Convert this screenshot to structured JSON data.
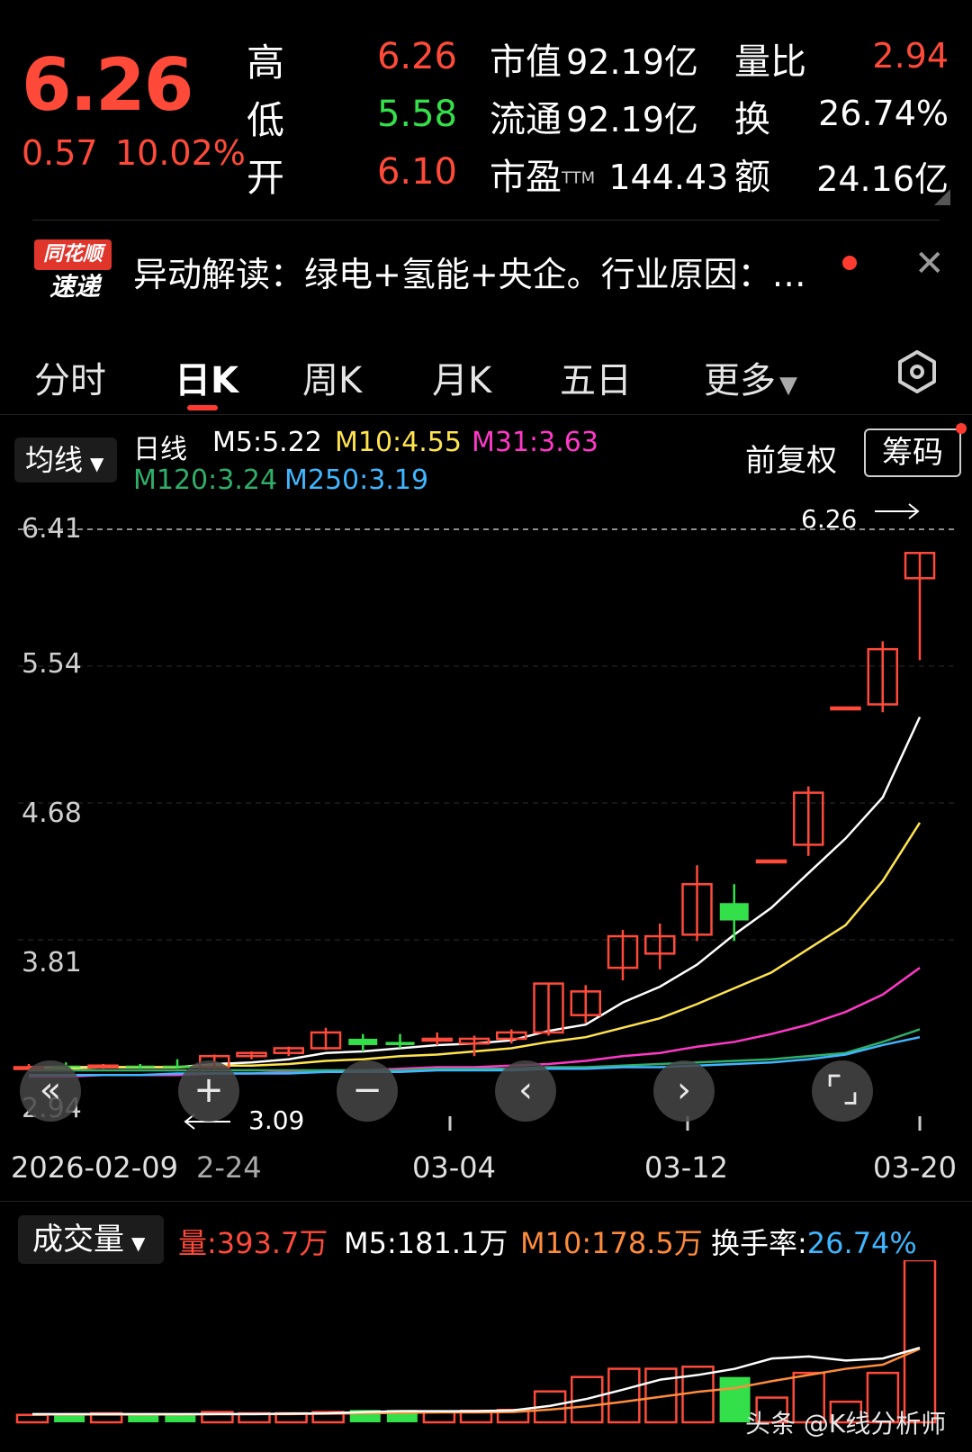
{
  "quote": {
    "price": "6.26",
    "change": "0.57",
    "change_pct": "10.02%",
    "high_label": "高",
    "high": "6.26",
    "low_label": "低",
    "low": "5.58",
    "open_label": "开",
    "open": "6.10",
    "mktcap_label": "市值",
    "mktcap": "92.19亿",
    "float_label": "流通",
    "float": "92.19亿",
    "pe_label": "市盈",
    "pe_sup": "TTM",
    "pe": "144.43",
    "volratio_label": "量比",
    "volratio": "2.94",
    "turnover_label": "换",
    "turnover": "26.74%",
    "amount_label": "额",
    "amount": "24.16亿",
    "colors": {
      "up": "#ff4a3a",
      "down": "#33e04a"
    }
  },
  "news": {
    "logo_top": "同花顺",
    "logo_bottom": "速递",
    "text": "异动解读：绿电+氢能+央企。行业原因：…"
  },
  "tabs": [
    {
      "label": "分时"
    },
    {
      "label": "日K",
      "active": true
    },
    {
      "label": "周K"
    },
    {
      "label": "月K"
    },
    {
      "label": "五日"
    },
    {
      "label": "更多"
    }
  ],
  "ma_bar": {
    "select": "均线",
    "day": "日线",
    "m5": "M5:5.22",
    "m10": "M10:4.55",
    "m31": "M31:3.63",
    "m120": "M120:3.24",
    "m250": "M250:3.19",
    "fuquan": "前复权",
    "chouma": "筹码"
  },
  "volume_bar": {
    "select": "成交量",
    "vol": "量:393.7万",
    "m5": "M5:181.1万",
    "m10": "M10:178.5万",
    "turnover_label": "换手率:",
    "turnover": "26.74%"
  },
  "watermark": "头条 @K线分析师",
  "chart_data": {
    "type": "candlestick",
    "y_ticks": [
      "6.41",
      "5.54",
      "4.68",
      "3.81",
      "2.94"
    ],
    "ylim": [
      2.94,
      6.41
    ],
    "x_ticks": [
      "2026-02-09",
      "2-24",
      "03-04",
      "03-12",
      "03-20"
    ],
    "high_marker": "6.26",
    "low_marker": "3.09",
    "candles": [
      {
        "o": 3.0,
        "h": 3.02,
        "l": 2.99,
        "c": 3.0
      },
      {
        "o": 3.01,
        "h": 3.03,
        "l": 2.99,
        "c": 3.0
      },
      {
        "o": 3.0,
        "h": 3.02,
        "l": 2.99,
        "c": 3.01
      },
      {
        "o": 3.01,
        "h": 3.02,
        "l": 2.99,
        "c": 3.0
      },
      {
        "o": 3.01,
        "h": 3.05,
        "l": 2.99,
        "c": 3.0
      },
      {
        "o": 3.0,
        "h": 3.08,
        "l": 2.99,
        "c": 3.07
      },
      {
        "o": 3.07,
        "h": 3.1,
        "l": 3.05,
        "c": 3.09
      },
      {
        "o": 3.09,
        "h": 3.13,
        "l": 3.07,
        "c": 3.12
      },
      {
        "o": 3.12,
        "h": 3.25,
        "l": 3.11,
        "c": 3.22
      },
      {
        "o": 3.18,
        "h": 3.21,
        "l": 3.1,
        "c": 3.14
      },
      {
        "o": 3.16,
        "h": 3.21,
        "l": 3.12,
        "c": 3.14
      },
      {
        "o": 3.17,
        "h": 3.22,
        "l": 3.14,
        "c": 3.18
      },
      {
        "o": 3.15,
        "h": 3.2,
        "l": 3.07,
        "c": 3.18
      },
      {
        "o": 3.18,
        "h": 3.24,
        "l": 3.15,
        "c": 3.22
      },
      {
        "o": 3.22,
        "h": 3.53,
        "l": 3.2,
        "c": 3.53
      },
      {
        "o": 3.33,
        "h": 3.52,
        "l": 3.28,
        "c": 3.48
      },
      {
        "o": 3.63,
        "h": 3.87,
        "l": 3.55,
        "c": 3.83
      },
      {
        "o": 3.72,
        "h": 3.91,
        "l": 3.62,
        "c": 3.83
      },
      {
        "o": 3.84,
        "h": 4.28,
        "l": 3.8,
        "c": 4.16
      },
      {
        "o": 4.04,
        "h": 4.16,
        "l": 3.8,
        "c": 3.93
      },
      {
        "o": 4.31,
        "h": 4.31,
        "l": 4.31,
        "c": 4.31
      },
      {
        "o": 4.41,
        "h": 4.78,
        "l": 4.34,
        "c": 4.74
      },
      {
        "o": 5.28,
        "h": 5.28,
        "l": 5.28,
        "c": 5.28
      },
      {
        "o": 5.3,
        "h": 5.7,
        "l": 5.25,
        "c": 5.65
      },
      {
        "o": 6.1,
        "h": 6.26,
        "l": 5.58,
        "c": 6.26
      }
    ],
    "ma_series": [
      {
        "name": "M5",
        "color": "#ffffff",
        "values": [
          3.0,
          3.0,
          3.0,
          3.0,
          3.0,
          3.02,
          3.03,
          3.05,
          3.09,
          3.1,
          3.12,
          3.14,
          3.15,
          3.17,
          3.23,
          3.27,
          3.41,
          3.51,
          3.65,
          3.84,
          4.01,
          4.23,
          4.45,
          4.71,
          5.22
        ]
      },
      {
        "name": "M10",
        "color": "#ffe44d",
        "values": [
          2.99,
          2.99,
          3.0,
          3.0,
          3.0,
          3.01,
          3.01,
          3.02,
          3.04,
          3.05,
          3.07,
          3.08,
          3.1,
          3.12,
          3.16,
          3.19,
          3.25,
          3.31,
          3.4,
          3.5,
          3.6,
          3.75,
          3.9,
          4.18,
          4.55
        ]
      },
      {
        "name": "M31",
        "color": "#ff38c8",
        "values": [
          2.94,
          2.94,
          2.95,
          2.95,
          2.95,
          2.96,
          2.96,
          2.97,
          2.98,
          2.98,
          2.99,
          3.0,
          3.0,
          3.01,
          3.02,
          3.04,
          3.07,
          3.09,
          3.13,
          3.16,
          3.21,
          3.27,
          3.35,
          3.46,
          3.63
        ]
      },
      {
        "name": "M120",
        "color": "#2fae6a",
        "values": [
          2.98,
          2.98,
          2.98,
          2.98,
          2.98,
          2.98,
          2.98,
          2.98,
          2.98,
          2.98,
          2.98,
          2.99,
          2.99,
          2.99,
          3.0,
          3.0,
          3.01,
          3.02,
          3.03,
          3.04,
          3.05,
          3.07,
          3.09,
          3.16,
          3.24
        ]
      },
      {
        "name": "M250",
        "color": "#3fb6ff",
        "values": [
          2.95,
          2.95,
          2.95,
          2.95,
          2.96,
          2.96,
          2.96,
          2.96,
          2.97,
          2.97,
          2.97,
          2.98,
          2.98,
          2.98,
          2.99,
          2.99,
          3.0,
          3.0,
          3.01,
          3.02,
          3.03,
          3.05,
          3.08,
          3.14,
          3.19
        ]
      }
    ],
    "volume": {
      "bars": [
        18,
        18,
        22,
        18,
        18,
        25,
        22,
        22,
        25,
        30,
        30,
        25,
        28,
        30,
        75,
        110,
        130,
        130,
        135,
        110,
        60,
        120,
        50,
        120,
        393.7
      ],
      "m5": [
        20,
        20,
        20,
        20,
        20,
        20,
        20,
        21,
        22,
        25,
        27,
        27,
        27,
        29,
        40,
        57,
        80,
        104,
        115,
        130,
        155,
        160,
        150,
        155,
        181.1
      ],
      "m10": [
        19,
        19,
        19,
        19,
        19,
        20,
        20,
        20,
        21,
        22,
        23,
        24,
        24,
        25,
        31,
        39,
        50,
        62,
        74,
        83,
        100,
        115,
        130,
        140,
        178.5
      ]
    }
  }
}
